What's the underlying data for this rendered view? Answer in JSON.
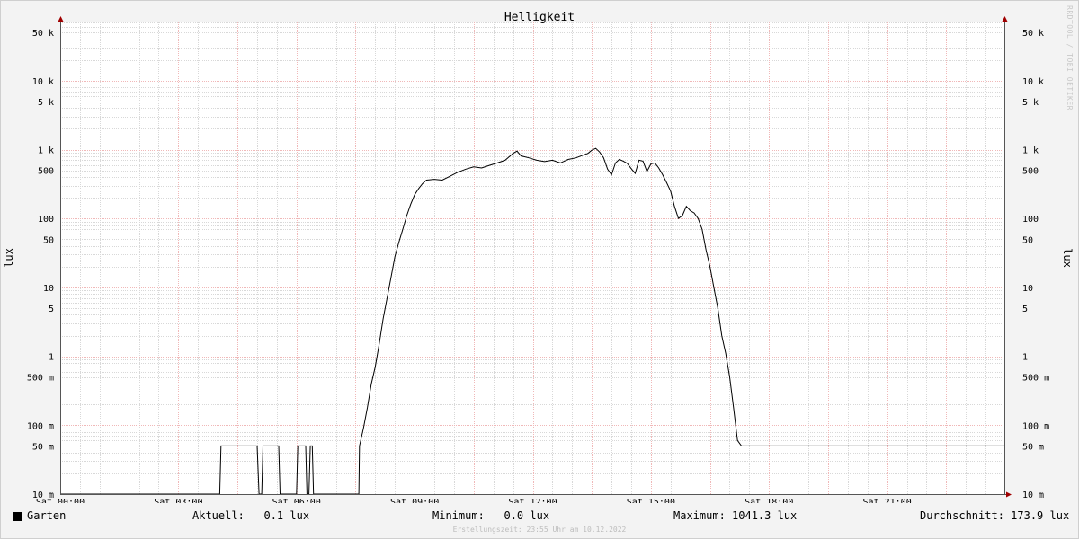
{
  "chart_data": {
    "type": "line",
    "title": "Helligkeit",
    "ylabel": "lux",
    "scale": "log",
    "ylim": [
      0.01,
      70000
    ],
    "xlim": [
      "00:00",
      "24:00"
    ],
    "x_ticks": [
      "Sat 00:00",
      "Sat 03:00",
      "Sat 06:00",
      "Sat 09:00",
      "Sat 12:00",
      "Sat 15:00",
      "Sat 18:00",
      "Sat 21:00"
    ],
    "y_ticks": [
      {
        "value": 0.01,
        "label": "10 m"
      },
      {
        "value": 0.05,
        "label": "50 m"
      },
      {
        "value": 0.1,
        "label": "100 m"
      },
      {
        "value": 0.5,
        "label": "500 m"
      },
      {
        "value": 1,
        "label": "1"
      },
      {
        "value": 5,
        "label": "5"
      },
      {
        "value": 10,
        "label": "10"
      },
      {
        "value": 50,
        "label": "50"
      },
      {
        "value": 100,
        "label": "100"
      },
      {
        "value": 500,
        "label": "500"
      },
      {
        "value": 1000,
        "label": "1 k"
      },
      {
        "value": 5000,
        "label": "5 k"
      },
      {
        "value": 10000,
        "label": "10 k"
      },
      {
        "value": 50000,
        "label": "50 k"
      }
    ],
    "series": [
      {
        "name": "Garten",
        "color": "#000000",
        "points": [
          [
            "00:00",
            0.01
          ],
          [
            "04:03",
            0.01
          ],
          [
            "04:05",
            0.05
          ],
          [
            "05:00",
            0.05
          ],
          [
            "05:03",
            0.01
          ],
          [
            "05:07",
            0.01
          ],
          [
            "05:09",
            0.05
          ],
          [
            "05:33",
            0.05
          ],
          [
            "05:35",
            0.01
          ],
          [
            "06:00",
            0.01
          ],
          [
            "06:02",
            0.05
          ],
          [
            "06:14",
            0.05
          ],
          [
            "06:16",
            0.01
          ],
          [
            "06:19",
            0.01
          ],
          [
            "06:21",
            0.05
          ],
          [
            "06:24",
            0.05
          ],
          [
            "06:26",
            0.01
          ],
          [
            "07:35",
            0.01
          ],
          [
            "07:36",
            0.05
          ],
          [
            "07:42",
            0.09
          ],
          [
            "07:48",
            0.18
          ],
          [
            "07:54",
            0.4
          ],
          [
            "08:00",
            0.7
          ],
          [
            "08:06",
            1.5
          ],
          [
            "08:12",
            3.5
          ],
          [
            "08:18",
            7
          ],
          [
            "08:24",
            14
          ],
          [
            "08:30",
            28
          ],
          [
            "08:36",
            45
          ],
          [
            "08:42",
            70
          ],
          [
            "08:48",
            110
          ],
          [
            "08:54",
            160
          ],
          [
            "09:00",
            220
          ],
          [
            "09:06",
            270
          ],
          [
            "09:12",
            320
          ],
          [
            "09:18",
            360
          ],
          [
            "09:30",
            370
          ],
          [
            "09:42",
            360
          ],
          [
            "09:54",
            410
          ],
          [
            "10:06",
            470
          ],
          [
            "10:18",
            520
          ],
          [
            "10:30",
            560
          ],
          [
            "10:42",
            540
          ],
          [
            "10:54",
            590
          ],
          [
            "11:06",
            640
          ],
          [
            "11:18",
            700
          ],
          [
            "11:30",
            880
          ],
          [
            "11:36",
            950
          ],
          [
            "11:42",
            810
          ],
          [
            "11:54",
            760
          ],
          [
            "12:06",
            700
          ],
          [
            "12:18",
            670
          ],
          [
            "12:30",
            700
          ],
          [
            "12:42",
            640
          ],
          [
            "12:54",
            720
          ],
          [
            "13:06",
            760
          ],
          [
            "13:18",
            840
          ],
          [
            "13:24",
            880
          ],
          [
            "13:30",
            980
          ],
          [
            "13:36",
            1041
          ],
          [
            "13:42",
            920
          ],
          [
            "13:48",
            760
          ],
          [
            "13:54",
            520
          ],
          [
            "14:00",
            430
          ],
          [
            "14:06",
            640
          ],
          [
            "14:12",
            720
          ],
          [
            "14:18",
            680
          ],
          [
            "14:24",
            630
          ],
          [
            "14:30",
            530
          ],
          [
            "14:36",
            450
          ],
          [
            "14:42",
            700
          ],
          [
            "14:48",
            680
          ],
          [
            "14:54",
            480
          ],
          [
            "15:00",
            620
          ],
          [
            "15:06",
            640
          ],
          [
            "15:12",
            540
          ],
          [
            "15:18",
            430
          ],
          [
            "15:24",
            330
          ],
          [
            "15:30",
            250
          ],
          [
            "15:36",
            150
          ],
          [
            "15:42",
            100
          ],
          [
            "15:48",
            110
          ],
          [
            "15:54",
            150
          ],
          [
            "16:00",
            130
          ],
          [
            "16:06",
            120
          ],
          [
            "16:12",
            100
          ],
          [
            "16:18",
            70
          ],
          [
            "16:24",
            35
          ],
          [
            "16:30",
            20
          ],
          [
            "16:36",
            10
          ],
          [
            "16:42",
            5
          ],
          [
            "16:48",
            2
          ],
          [
            "16:54",
            1.1
          ],
          [
            "17:00",
            0.5
          ],
          [
            "17:06",
            0.18
          ],
          [
            "17:12",
            0.06
          ],
          [
            "17:18",
            0.05
          ],
          [
            "24:00",
            0.05
          ]
        ]
      }
    ]
  },
  "legend": {
    "series_name": "Garten",
    "current": "Aktuell:   0.1 lux",
    "minimum": "Minimum:   0.0 lux",
    "maximum": "Maximum: 1041.3 lux",
    "average": "Durchschnitt: 173.9 lux"
  },
  "footer": "Erstellungszeit: 23:55 Uhr am 10.12.2022",
  "watermark": "RRDTOOL / TOBI OETIKER"
}
